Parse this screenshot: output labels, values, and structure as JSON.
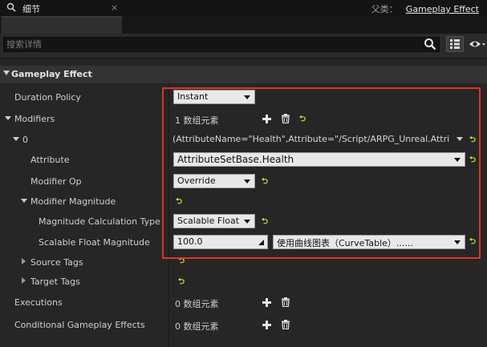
{
  "header": {
    "parent_label": "父类：",
    "parent_value": "Gameplay Effect"
  },
  "tab": {
    "label": "细节",
    "icon": "magnifier-icon",
    "close": "×"
  },
  "search": {
    "placeholder": "搜索详情",
    "icon": "search-icon"
  },
  "toolbar": {
    "grid_icon": "grid-view-icon",
    "eye_icon": "eye-icon"
  },
  "section": {
    "title": "Gameplay Effect"
  },
  "rows": {
    "duration_policy": {
      "label": "Duration Policy",
      "value": "Instant"
    },
    "modifiers": {
      "label": "Modifiers",
      "value": "1 数组元素"
    },
    "element0": {
      "label": "0",
      "value": "(AttributeName=\"Health\",Attribute=\"/Script/ARPG_Unreal.AttributeS"
    },
    "attribute": {
      "label": "Attribute",
      "value": "AttributeSetBase.Health"
    },
    "modifier_op": {
      "label": "Modifier Op",
      "value": "Override"
    },
    "modifier_magnitude": {
      "label": "Modifier Magnitude"
    },
    "magnitude_calc": {
      "label": "Magnitude Calculation Type",
      "value": "Scalable Float"
    },
    "scalable_float": {
      "label": "Scalable Float Magnitude",
      "value": "100.0",
      "curve": "使用曲线图表（CurveTable）......"
    },
    "source_tags": {
      "label": "Source Tags"
    },
    "target_tags": {
      "label": "Target Tags"
    },
    "executions": {
      "label": "Executions",
      "value": "0 数组元素"
    },
    "conditional": {
      "label": "Conditional Gameplay Effects",
      "value": "0 数组元素"
    }
  },
  "colors": {
    "highlight_box": "#e0322b",
    "reset_arrow": "#e8e23c"
  }
}
